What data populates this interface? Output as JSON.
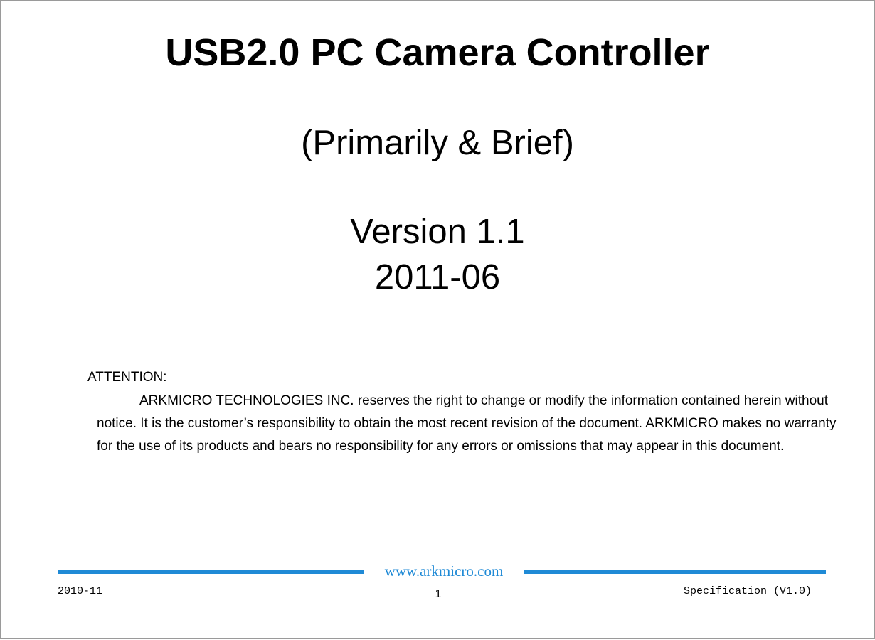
{
  "document": {
    "title": "USB2.0 PC Camera Controller",
    "subtitle": "(Primarily & Brief)",
    "version": "Version 1.1",
    "date": "2011-06"
  },
  "attention": {
    "heading": "ATTENTION:",
    "body": "ARKMICRO TECHNOLOGIES INC. reserves the right to change or modify the information contained herein without notice. It is the customer’s responsibility to obtain the most recent revision of the document. ARKMICRO makes no warranty for the use of its products and bears no responsibility for any errors or omissions that may appear in this document."
  },
  "footer": {
    "url": "www.arkmicro.com",
    "left_date": "2010-11",
    "page_number": "1",
    "spec_label": "Specification (V1.0)",
    "accent_color": "#1f8ad6"
  }
}
